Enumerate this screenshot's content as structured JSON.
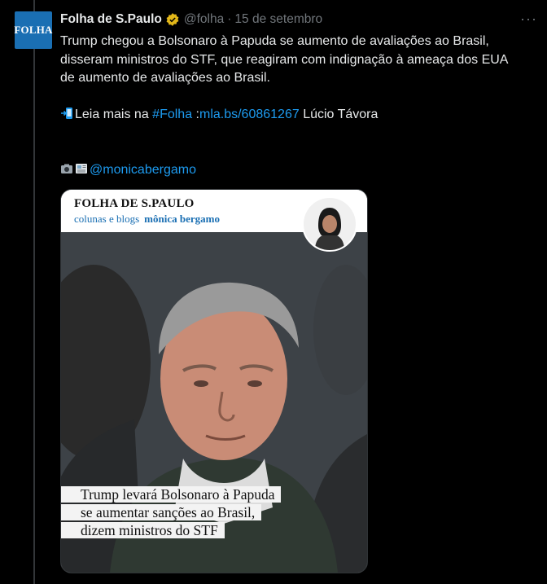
{
  "account": {
    "avatar_text": "FOLHA",
    "display_name": "Folha de S.Paulo",
    "handle": "@folha",
    "separator": "·",
    "date": "15 de setembro",
    "more_label": "···"
  },
  "tweet": {
    "line1": "Trump chegou a Bolsonaro à Papuda se aumento de avaliações ao Brasil,",
    "line2": "disseram ministros do STF, que reagiram com indignação à ameaça dos EUA",
    "line3": "de aumento de avaliações ao Brasil.",
    "read_more_prefix": "Leia mais na ",
    "hashtag": "#Folha",
    "colon": " :",
    "url": "mla.bs/60861267",
    "author": " Lúcio Távora",
    "mention": "@monicabergamo"
  },
  "card": {
    "brand": "FOLHA DE S.PAULO",
    "section": "colunas e blogs",
    "columnist": "mônica bergamo",
    "headline_lines": [
      "Trump levará Bolsonaro à Papuda",
      "se aumentar sanções ao Brasil,",
      "dizem ministros do STF"
    ]
  },
  "colors": {
    "background": "#000000",
    "text": "#e7e9ea",
    "muted": "#71767b",
    "link": "#1d9bf0",
    "folha_blue": "#1a6fb3",
    "verified_gold": "#e2b719"
  },
  "icons": {
    "verified": "verified-badge-icon",
    "read_more": "arrow-phone-icon",
    "camera": "camera-icon",
    "newspaper": "newspaper-icon"
  }
}
